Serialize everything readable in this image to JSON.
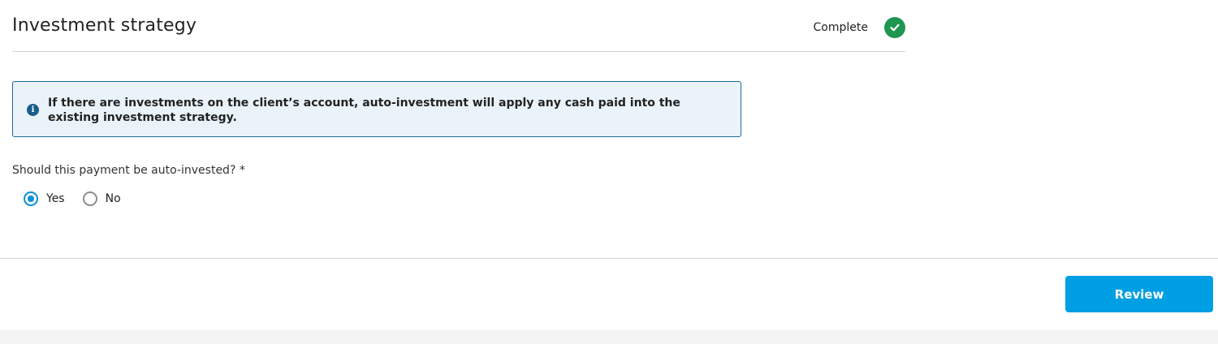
{
  "section": {
    "title": "Investment strategy",
    "status": "Complete",
    "status_icon": "check-circle-icon",
    "status_color": "#1e9651"
  },
  "info": {
    "icon": "info-icon",
    "text": "If there are investments on the client’s account, auto-investment will apply any cash paid into the existing investment strategy."
  },
  "question": {
    "label": "Should this payment be auto-invested? *",
    "options": [
      {
        "label": "Yes",
        "selected": true
      },
      {
        "label": "No",
        "selected": false
      }
    ]
  },
  "footer": {
    "review_label": "Review",
    "accent_color": "#009fe3"
  }
}
